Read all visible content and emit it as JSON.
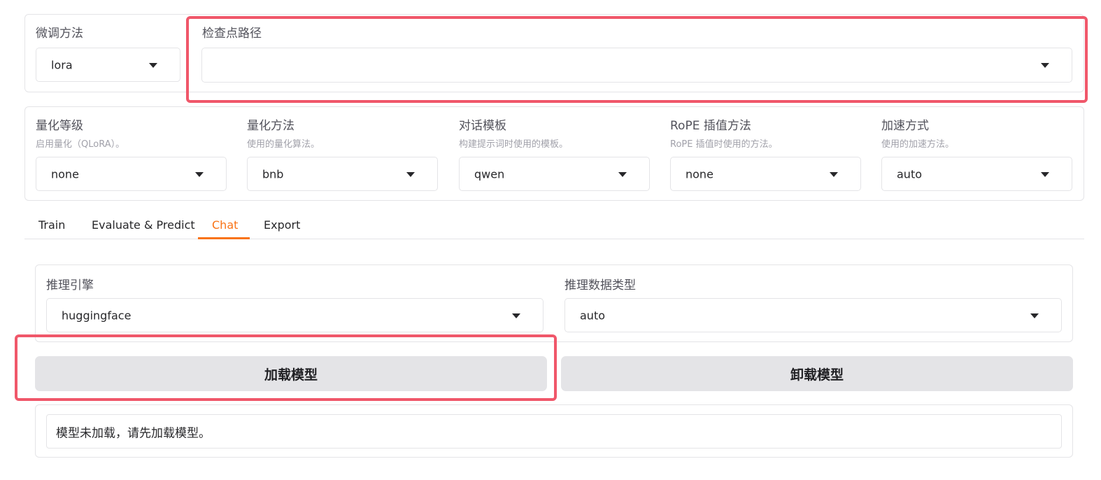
{
  "top": {
    "finetune": {
      "label": "微调方法",
      "value": "lora"
    },
    "checkpoint": {
      "label": "检查点路径",
      "value": ""
    }
  },
  "quant": {
    "level": {
      "label": "量化等级",
      "hint": "启用量化（QLoRA）。",
      "value": "none"
    },
    "method": {
      "label": "量化方法",
      "hint": "使用的量化算法。",
      "value": "bnb"
    },
    "template": {
      "label": "对话模板",
      "hint": "构建提示词时使用的模板。",
      "value": "qwen"
    },
    "rope": {
      "label": "RoPE 插值方法",
      "hint": "RoPE 插值时使用的方法。",
      "value": "none"
    },
    "accel": {
      "label": "加速方式",
      "hint": "使用的加速方法。",
      "value": "auto"
    }
  },
  "tabs": [
    {
      "label": "Train"
    },
    {
      "label": "Evaluate & Predict"
    },
    {
      "label": "Chat",
      "active": true
    },
    {
      "label": "Export"
    }
  ],
  "chat": {
    "engine": {
      "label": "推理引擎",
      "value": "huggingface"
    },
    "dtype": {
      "label": "推理数据类型",
      "value": "auto"
    },
    "load_button": "加载模型",
    "unload_button": "卸载模型",
    "status": "模型未加载，请先加载模型。"
  },
  "colors": {
    "accent": "#f97316",
    "highlight": "#f0576a",
    "button_bg": "#e4e4e7"
  }
}
